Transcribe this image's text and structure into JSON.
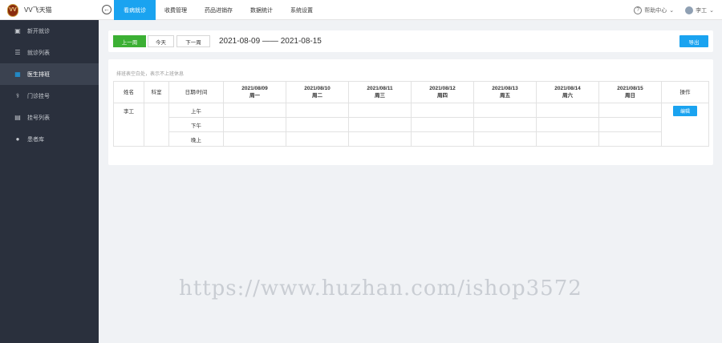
{
  "app": {
    "logo_text": "VV飞天猫",
    "logo_mark": "VV"
  },
  "topnav": {
    "items": [
      {
        "label": "看病就诊",
        "active": true
      },
      {
        "label": "收费管理",
        "active": false
      },
      {
        "label": "药品进销存",
        "active": false
      },
      {
        "label": "数据统计",
        "active": false
      },
      {
        "label": "系统设置",
        "active": false
      }
    ],
    "help_label": "帮助中心",
    "user_name": "李工"
  },
  "sidebar": {
    "items": [
      {
        "label": "新开就诊",
        "icon": "medkit-icon",
        "active": false
      },
      {
        "label": "就诊列表",
        "icon": "list-icon",
        "active": false
      },
      {
        "label": "医生排班",
        "icon": "calendar-icon",
        "active": true
      },
      {
        "label": "门诊挂号",
        "icon": "stethoscope-icon",
        "active": false
      },
      {
        "label": "挂号列表",
        "icon": "id-card-icon",
        "active": false
      },
      {
        "label": "患者库",
        "icon": "user-icon",
        "active": false
      }
    ]
  },
  "toolbar": {
    "prev_label": "上一周",
    "today_label": "今天",
    "next_label": "下一周",
    "date_range": "2021-08-09 —— 2021-08-15",
    "export_label": "导出"
  },
  "schedule": {
    "hint": "排班表空白处，表示不上班休息",
    "headers": {
      "name": "姓名",
      "dept": "科室",
      "period": "日期/时间",
      "op": "操作"
    },
    "days": [
      {
        "date": "2021/08/09",
        "weekday": "周一"
      },
      {
        "date": "2021/08/10",
        "weekday": "周二"
      },
      {
        "date": "2021/08/11",
        "weekday": "周三"
      },
      {
        "date": "2021/08/12",
        "weekday": "周四"
      },
      {
        "date": "2021/08/13",
        "weekday": "周五"
      },
      {
        "date": "2021/08/14",
        "weekday": "周六"
      },
      {
        "date": "2021/08/15",
        "weekday": "周日"
      }
    ],
    "doctor": {
      "name": "李工",
      "dept": ""
    },
    "periods": [
      "上午",
      "下午",
      "晚上"
    ],
    "edit_label": "编辑"
  },
  "watermark": "https://www.huzhan.com/ishop3572"
}
